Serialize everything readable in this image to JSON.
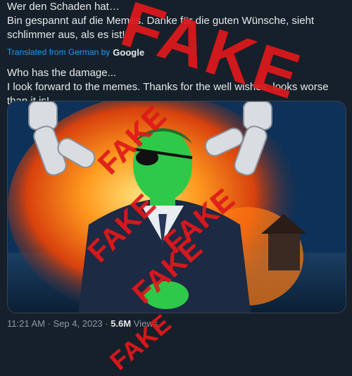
{
  "tweet": {
    "original_text": "Wer den Schaden hat…\nBin gespannt auf die Memes. Danke für die guten Wünsche, sieht schlimmer aus, als es ist!",
    "translated_label": "Translated from German by",
    "translator": "Google",
    "translation": "Who has the damage...\nI look forward to the memes. Thanks for the well wishes, looks worse than it is!",
    "time": "11:21 AM",
    "date": "Sep 4, 2023",
    "views_count": "5.6M",
    "views_label": "Views"
  },
  "stamps": {
    "large": "FAKE",
    "small": "FAKE"
  },
  "colors": {
    "background": "#15202b",
    "link": "#1d9bf0",
    "stamp": "#e0191c"
  }
}
